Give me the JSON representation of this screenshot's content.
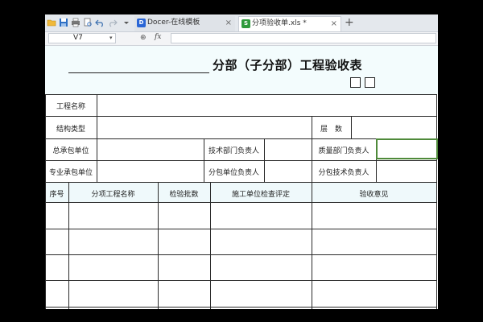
{
  "toolbar": {
    "icons": [
      "folder-icon",
      "save-icon",
      "print-icon",
      "print-preview-icon",
      "undo-icon",
      "redo-icon",
      "dropdown-icon"
    ]
  },
  "tabs": [
    {
      "label": "Docer-在线模板",
      "icon": "docer-icon",
      "close": "×",
      "active": false
    },
    {
      "label": "分项验收单.xls *",
      "icon": "spreadsheet-icon",
      "close": "×",
      "active": true
    }
  ],
  "newtab": "+",
  "formula_bar": {
    "cell_ref": "V7",
    "fx": "fx",
    "formula": ""
  },
  "sheet": {
    "title": "分部（子分部）工程验收表",
    "info_rows": {
      "project_name_label": "工程名称",
      "structure_type_label": "结构类型",
      "floors_label": "层　数",
      "general_contractor_label": "总承包单位",
      "tech_head_label": "技术部门负责人",
      "quality_head_label": "质量部门负责人",
      "sub_contractor_label": "专业承包单位",
      "sub_unit_head_label": "分包单位负责人",
      "sub_tech_head_label": "分包技术负责人"
    },
    "columns": [
      "序号",
      "分项工程名称",
      "检验批数",
      "施工单位检查评定",
      "验收意见"
    ]
  }
}
